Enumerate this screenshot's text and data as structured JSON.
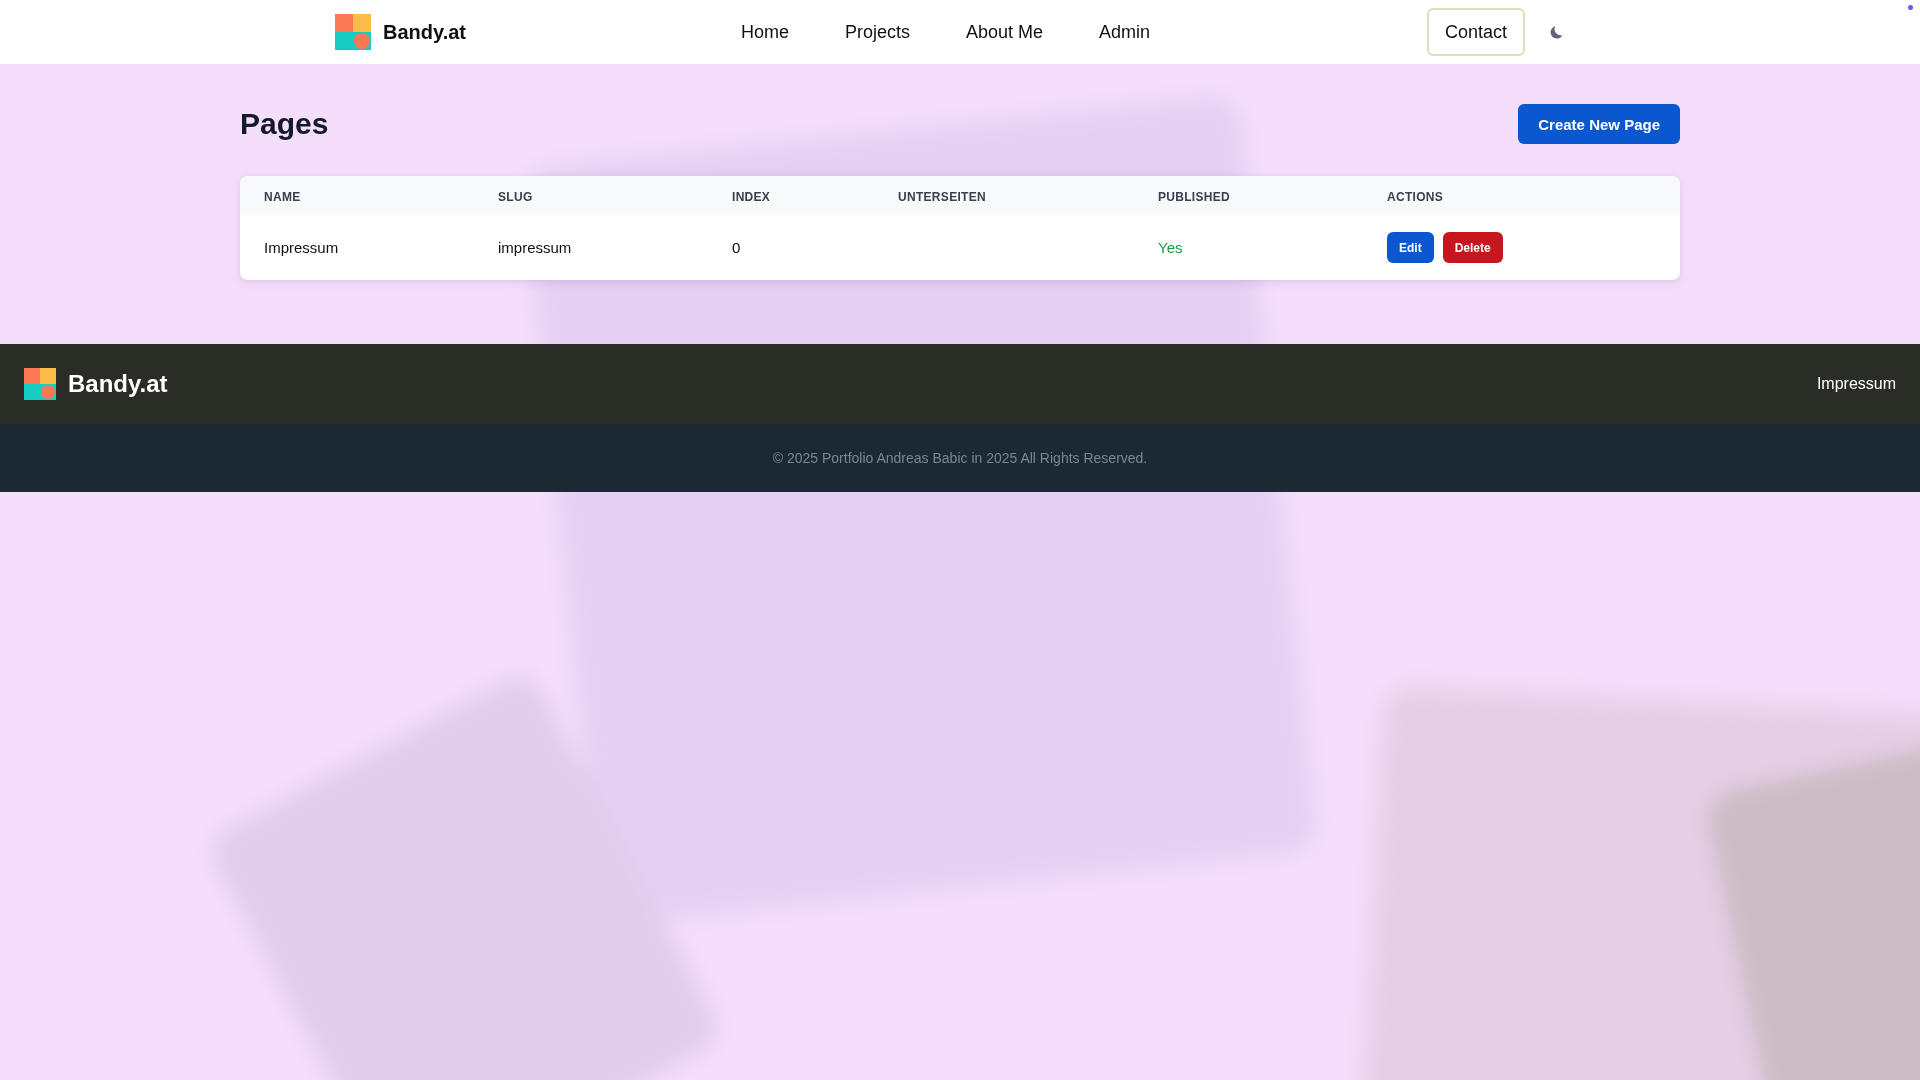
{
  "header": {
    "brand": "Bandy.at",
    "nav": [
      "Home",
      "Projects",
      "About Me",
      "Admin"
    ],
    "contact": "Contact"
  },
  "page": {
    "title": "Pages",
    "create_button": "Create New Page"
  },
  "table": {
    "columns": [
      "NAME",
      "SLUG",
      "INDEX",
      "UNTERSEITEN",
      "PUBLISHED",
      "ACTIONS"
    ],
    "rows": [
      {
        "name": "Impressum",
        "slug": "impressum",
        "index": "0",
        "unterseiten": "",
        "published": "Yes",
        "actions": [
          "Edit",
          "Delete"
        ]
      }
    ]
  },
  "footer": {
    "brand": "Bandy.at",
    "link": "Impressum",
    "copyright": "© 2025 Portfolio Andreas Babic in 2025 All Rights Reserved."
  }
}
